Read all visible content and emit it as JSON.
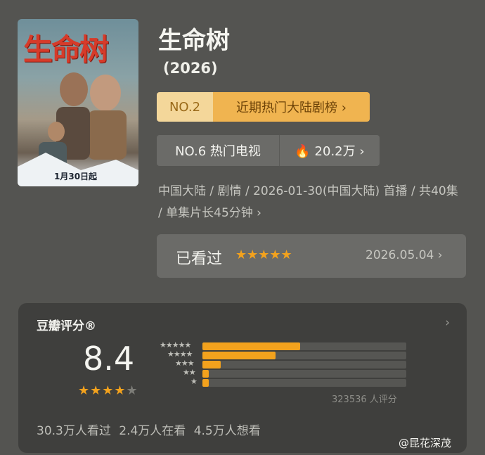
{
  "poster": {
    "title": "生命树",
    "date": "1月30日起"
  },
  "show": {
    "title": "生命树",
    "year": "(2026)"
  },
  "rank_primary": {
    "no": "NO.2",
    "label": "近期热门大陆剧榜 ›"
  },
  "rank_secondary": {
    "no": "NO.6 热门电视",
    "heat": "🔥 20.2万 ›"
  },
  "meta": "中国大陆 / 剧情 / 2026-01-30(中国大陆) 首播 / 共40集 / 单集片长45分钟 ›",
  "watched": {
    "label": "已看过",
    "stars": "★★★★★",
    "date": "2026.05.04 ›"
  },
  "rating": {
    "header": "豆瓣评分®",
    "arrow": "›",
    "score": "8.4",
    "stars_on": "★★★★",
    "stars_off": "★",
    "count": "323536 人评分",
    "distribution": [
      {
        "stars": "★★★★★",
        "fraction": 0.48
      },
      {
        "stars": "★★★★",
        "fraction": 0.36
      },
      {
        "stars": "★★★",
        "fraction": 0.09
      },
      {
        "stars": "★★",
        "fraction": 0.03
      },
      {
        "stars": "★",
        "fraction": 0.03
      }
    ],
    "footer": "30.3万人看过  2.4万人在看  4.5万人想看"
  },
  "watermark": "@昆花深茂",
  "colors": {
    "accent": "#f3a21d",
    "background": "#545451",
    "card": "#3f3f3d"
  }
}
